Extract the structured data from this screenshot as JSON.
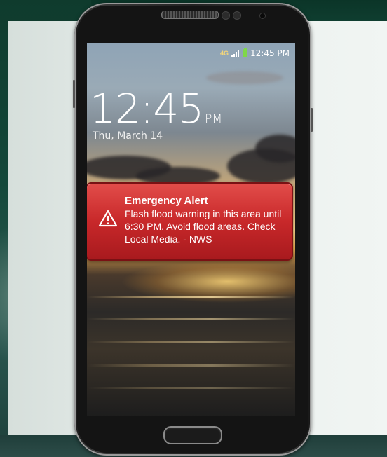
{
  "status_bar": {
    "network": "4G",
    "time": "12:45 PM"
  },
  "lock_screen": {
    "clock_time": "12:45",
    "clock_ampm": "PM",
    "date": "Thu, March 14"
  },
  "alert": {
    "title": "Emergency Alert",
    "message": "Flash flood warning in this area until 6:30 PM. Avoid flood areas. Check Local Media. - NWS",
    "icon": "warning-triangle-icon",
    "color": "#c8282a"
  }
}
